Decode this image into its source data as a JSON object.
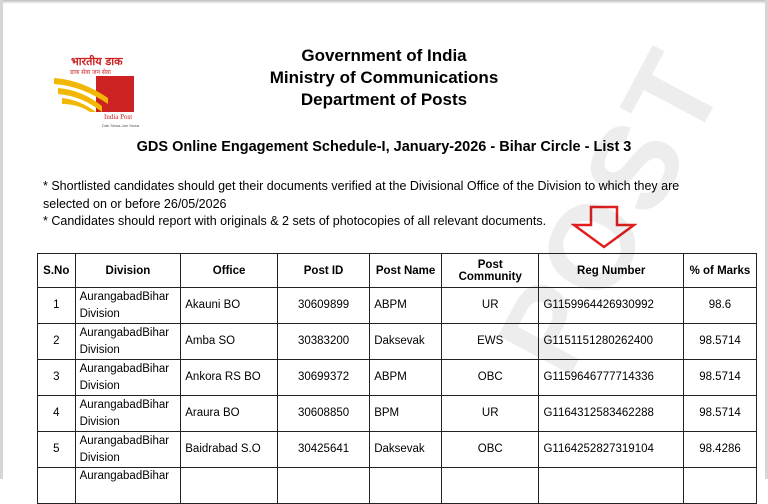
{
  "logo": {
    "hindi": "भारतीय डाक",
    "hindi_sub": "डाक सेवा जन सेवा",
    "name": "India Post",
    "tagline": "Dak Sewa-Jan Sewa",
    "colors": {
      "red": "#cc2222",
      "yellow": "#f2b705"
    }
  },
  "header": {
    "line1": "Government of India",
    "line2": "Ministry of Communications",
    "line3": "Department of Posts"
  },
  "subtitle": "GDS Online Engagement Schedule-I, January-2026 - Bihar Circle - List 3",
  "notes": [
    "* Shortlisted candidates should get their documents verified at the Divisional Office of the Division to which they are selected on or before 26/05/2026",
    "* Candidates should report with originals & 2 sets of photocopies of all relevant documents."
  ],
  "annotation": {
    "icon": "down-arrow-icon",
    "color": "#e02020"
  },
  "watermark": "POST",
  "table": {
    "headers": [
      "S.No",
      "Division",
      "Office",
      "Post ID",
      "Post Name",
      "Post Community",
      "Reg Number",
      "% of Marks"
    ],
    "rows": [
      [
        "1",
        "AurangabadBihar Division",
        "Akauni BO",
        "30609899",
        "ABPM",
        "UR",
        "G1159964426930992",
        "98.6"
      ],
      [
        "2",
        "AurangabadBihar Division",
        "Amba SO",
        "30383200",
        "Daksevak",
        "EWS",
        "G1151151280262400",
        "98.5714"
      ],
      [
        "3",
        "AurangabadBihar Division",
        "Ankora RS BO",
        "30699372",
        "ABPM",
        "OBC",
        "G1159646777714336",
        "98.5714"
      ],
      [
        "4",
        "AurangabadBihar Division",
        "Araura BO",
        "30608850",
        "BPM",
        "UR",
        "G1164312583462288",
        "98.5714"
      ],
      [
        "5",
        "AurangabadBihar Division",
        "Baidrabad S.O",
        "30425641",
        "Daksevak",
        "OBC",
        "G1164252827319104",
        "98.4286"
      ],
      [
        "",
        "AurangabadBihar",
        "",
        "",
        "",
        "",
        "",
        ""
      ]
    ]
  }
}
